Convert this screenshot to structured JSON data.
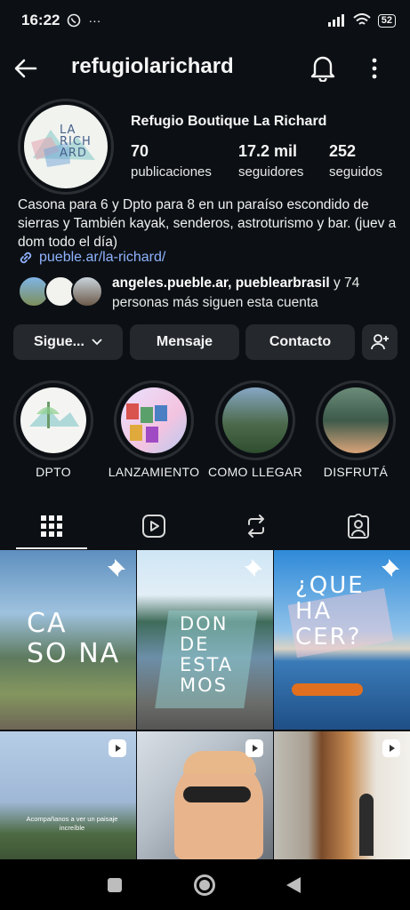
{
  "status_bar": {
    "time": "16:22",
    "more": "···",
    "battery": "52"
  },
  "header": {
    "username": "refugiolarichard"
  },
  "profile": {
    "avatar_logo_text": "LA\nRICH\nARD",
    "display_name": "Refugio Boutique La Richard",
    "stats": [
      {
        "value": "70",
        "label": "publicaciones"
      },
      {
        "value": "17.2 mil",
        "label": "seguidores"
      },
      {
        "value": "252",
        "label": "seguidos"
      }
    ],
    "bio": "Casona para 6 y Dpto para 8  en  un paraíso escondido de sierras y También kayak, senderos, astroturismo y bar. (juev a dom todo el día)",
    "link": "pueble.ar/la-richard/",
    "followed_by": {
      "names": "angeles.pueble.ar, pueblearbrasil",
      "rest": " y 74 personas más siguen esta cuenta"
    }
  },
  "buttons": {
    "following": "Sigue...",
    "message": "Mensaje",
    "contact": "Contacto"
  },
  "highlights": [
    {
      "label": "DPTO"
    },
    {
      "label": "LANZAMIENTO"
    },
    {
      "label": "COMO LLEGAR"
    },
    {
      "label": "DISFRUTÁ"
    }
  ],
  "grid": {
    "post1_text": "CA\nSO NA",
    "post2_text": "DON\nDE\nESTA\nMOS",
    "post3_text": "¿QUE\nHA\nCER?",
    "post4_text": "Acompañanos a ver un paisaje increíble"
  },
  "colors": {
    "background": "#0c1014",
    "button": "#25292e",
    "link": "#8fb2ff"
  }
}
